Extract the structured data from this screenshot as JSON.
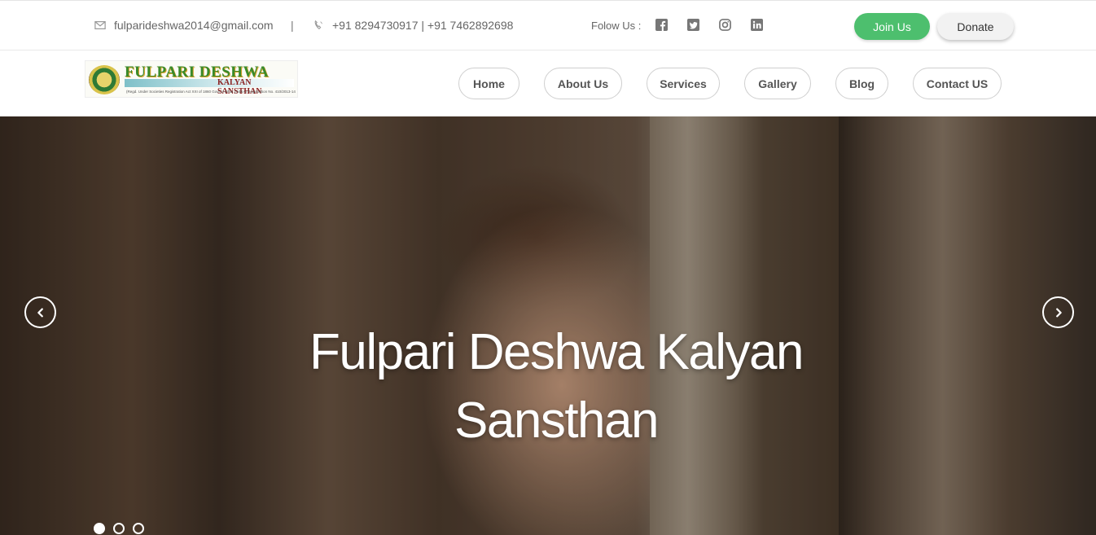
{
  "topbar": {
    "email": "fulparideshwa2014@gmail.com",
    "separator": "|",
    "phone": "+91 8294730917 | +91 7462892698",
    "follow_label": "Folow Us :",
    "socials": [
      "facebook-icon",
      "twitter-icon",
      "instagram-icon",
      "linkedin-icon"
    ],
    "join_label": "Join Us",
    "donate_label": "Donate"
  },
  "logo": {
    "brand": "FULPARI DESHWA",
    "subtitle": "KALYAN SANSTHAN",
    "fine_print": "(Regd. Under Societies Registration Act XXI of 1860 Govt of Bihar (INDIA) Registration No. 410/2013-14"
  },
  "nav": {
    "items": [
      {
        "label": "Home"
      },
      {
        "label": "About Us"
      },
      {
        "label": "Services"
      },
      {
        "label": "Gallery"
      },
      {
        "label": "Blog"
      },
      {
        "label": "Contact US"
      }
    ]
  },
  "hero": {
    "title": "Fulpari Deshwa Kalyan Sansthan",
    "slides_total": 3,
    "active_slide": 1
  },
  "colors": {
    "join_button": "#4dbf6e",
    "donate_button": "#f2f2f2"
  }
}
